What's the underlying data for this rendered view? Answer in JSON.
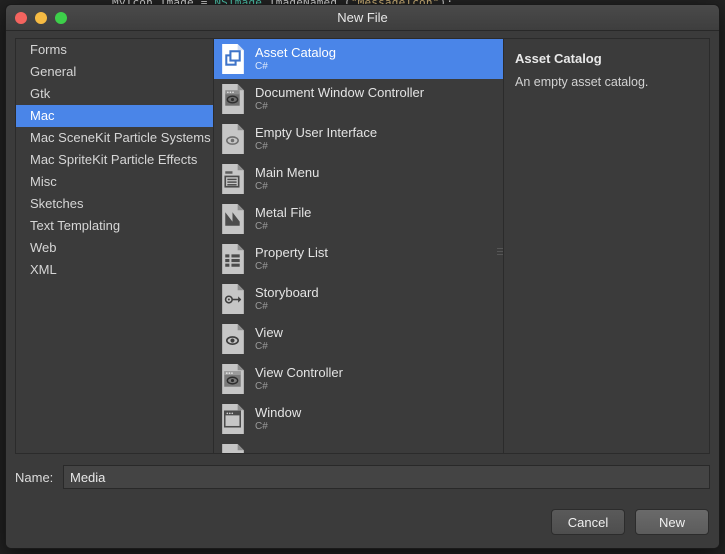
{
  "background": {
    "code_line": {
      "part1": "MyIcon.Image = ",
      "part2": "NSImage",
      "part3": ".ImageNamed (",
      "part4": "\"MessageIcon\"",
      "part5": ");"
    }
  },
  "window": {
    "title": "New File",
    "controls": {
      "close": "close-button",
      "minimize": "minimize-button",
      "maximize": "maximize-button"
    }
  },
  "categories": {
    "items": [
      {
        "label": "Forms",
        "selected": false
      },
      {
        "label": "General",
        "selected": false
      },
      {
        "label": "Gtk",
        "selected": false
      },
      {
        "label": "Mac",
        "selected": true
      },
      {
        "label": "Mac SceneKit Particle Systems",
        "selected": false
      },
      {
        "label": "Mac SpriteKit Particle Effects",
        "selected": false
      },
      {
        "label": "Misc",
        "selected": false
      },
      {
        "label": "Sketches",
        "selected": false
      },
      {
        "label": "Text Templating",
        "selected": false
      },
      {
        "label": "Web",
        "selected": false
      },
      {
        "label": "XML",
        "selected": false
      }
    ]
  },
  "templates": {
    "items": [
      {
        "name": "Asset Catalog",
        "language": "C#",
        "icon": "asset-catalog-icon",
        "selected": true
      },
      {
        "name": "Document Window Controller",
        "language": "C#",
        "icon": "document-window-controller-icon",
        "selected": false
      },
      {
        "name": "Empty User Interface",
        "language": "C#",
        "icon": "empty-user-interface-icon",
        "selected": false
      },
      {
        "name": "Main Menu",
        "language": "C#",
        "icon": "main-menu-icon",
        "selected": false
      },
      {
        "name": "Metal File",
        "language": "C#",
        "icon": "metal-file-icon",
        "selected": false
      },
      {
        "name": "Property List",
        "language": "C#",
        "icon": "property-list-icon",
        "selected": false
      },
      {
        "name": "Storyboard",
        "language": "C#",
        "icon": "storyboard-icon",
        "selected": false
      },
      {
        "name": "View",
        "language": "C#",
        "icon": "view-icon",
        "selected": false
      },
      {
        "name": "View Controller",
        "language": "C#",
        "icon": "view-controller-icon",
        "selected": false
      },
      {
        "name": "Window",
        "language": "C#",
        "icon": "window-icon",
        "selected": false
      }
    ]
  },
  "details": {
    "title": "Asset Catalog",
    "description": "An empty asset catalog."
  },
  "name_field": {
    "label": "Name:",
    "value": "Media",
    "placeholder": ""
  },
  "buttons": {
    "cancel": "Cancel",
    "new": "New"
  },
  "colors": {
    "selection_blue": "#4a85e8",
    "window_bg": "#3b3b3b",
    "titlebar": "#454545",
    "close": "#f4645f",
    "minimize": "#f6bb43",
    "maximize": "#3dcf4a"
  }
}
